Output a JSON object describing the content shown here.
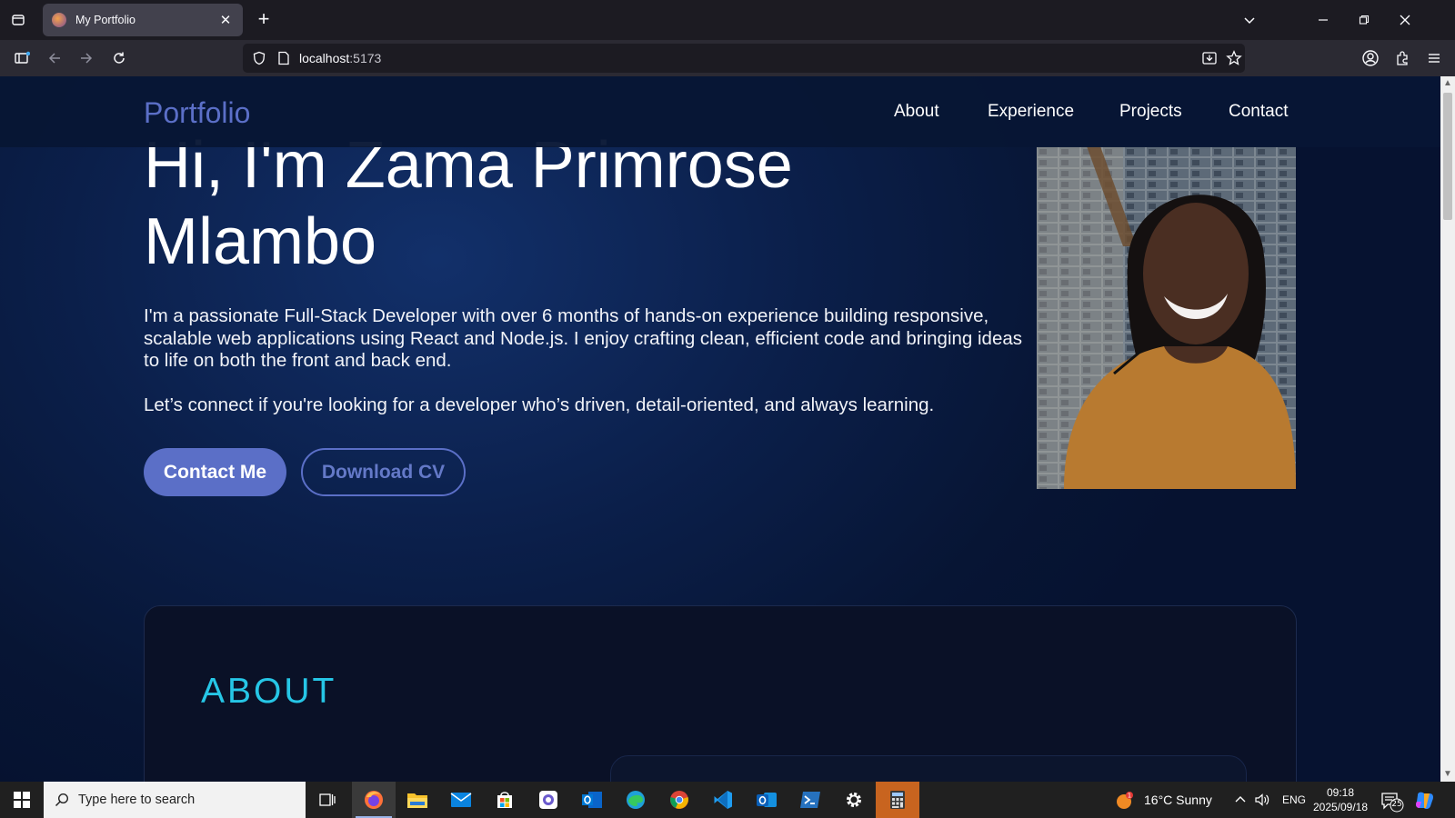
{
  "browser": {
    "tab_title": "My Portfolio",
    "url_host": "localhost",
    "url_port": ":5173"
  },
  "site": {
    "brand": "Portfolio",
    "nav": [
      "About",
      "Experience",
      "Projects",
      "Contact"
    ],
    "hero": {
      "title_line1": "Hi, I'm Zama Primrose",
      "title_line2": "Mlambo",
      "paragraph1": "I'm a passionate Full-Stack Developer with over 6 months of hands-on experience building responsive, scalable web applications using React and Node.js. I enjoy crafting clean, efficient code and bringing ideas to life on both the front and back end.",
      "paragraph2": "Let’s connect if you're looking for a developer who’s driven, detail-oriented, and always learning.",
      "contact_button": "Contact Me",
      "cv_button": "Download CV"
    },
    "about": {
      "title": "ABOUT"
    }
  },
  "taskbar": {
    "search_placeholder": "Type here to search",
    "weather": "16°C  Sunny",
    "language": "ENG",
    "time": "09:18",
    "date": "2025/09/18",
    "notification_count": "25"
  },
  "colors": {
    "accent": "#5b6fc7",
    "about_title": "#26c6e6",
    "page_bg": "#0b1f4a"
  }
}
